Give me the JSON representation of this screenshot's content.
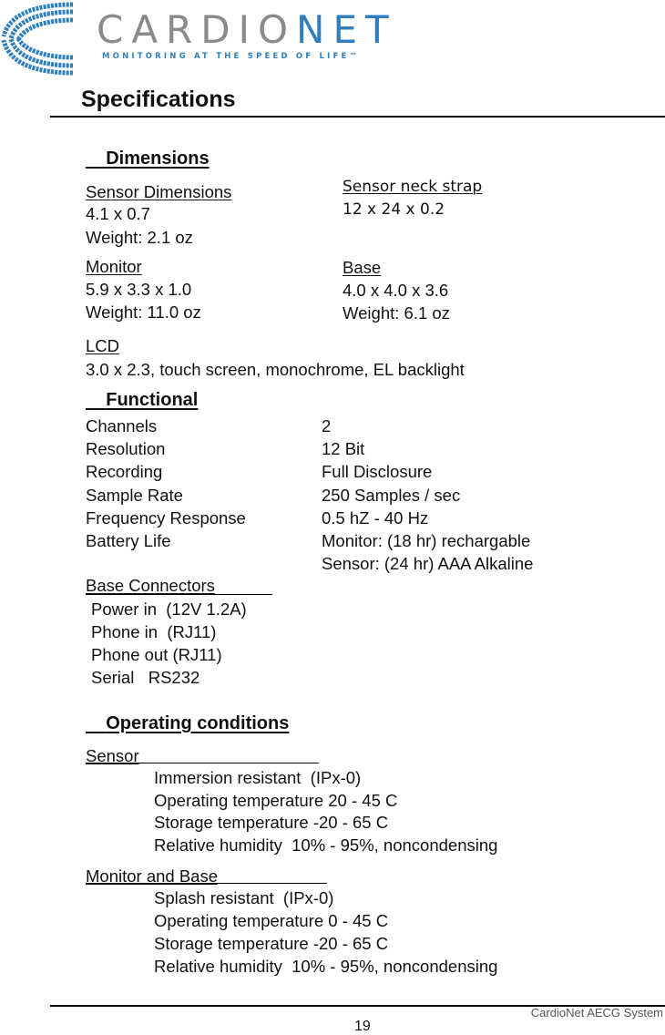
{
  "header": {
    "brand_primary": "CARDIO",
    "brand_secondary": "NET",
    "tagline": "MONITORING AT THE SPEED OF LIFE™",
    "brand_colors": {
      "gray": "#8a8a8a",
      "blue": "#2f7fbf"
    }
  },
  "page_title": "Specifications",
  "dimensions": {
    "heading": "Dimensions",
    "sensor": {
      "label": "Sensor Dimensions",
      "size": "4.1 x 0.7",
      "weight": "Weight: 2.1 oz"
    },
    "neck_strap": {
      "label": "Sensor neck strap",
      "size": "12 x 24 x 0.2"
    },
    "monitor": {
      "label": "Monitor",
      "size": "5.9 x 3.3 x 1.0",
      "weight": "Weight: 11.0 oz"
    },
    "base": {
      "label": "Base",
      "size": "4.0 x 4.0 x 3.6",
      "weight": "Weight: 6.1 oz"
    },
    "lcd": {
      "label": "LCD",
      "desc": "3.0 x 2.3, touch screen, monochrome, EL backlight"
    }
  },
  "functional": {
    "heading": "Functional",
    "rows": [
      {
        "label": "Channels",
        "value": "2"
      },
      {
        "label": "Resolution",
        "value": "12 Bit"
      },
      {
        "label": "Recording",
        "value": "Full Disclosure"
      },
      {
        "label": "Sample Rate",
        "value": "250 Samples / sec"
      },
      {
        "label": "Frequency Response",
        "value": "0.5 hZ - 40 Hz"
      },
      {
        "label": "Battery Life",
        "value": "Monitor: (18 hr) rechargable"
      },
      {
        "label": "",
        "value": "Sensor: (24 hr) AAA Alkaline"
      }
    ],
    "connectors": {
      "label": "Base Connectors",
      "items": [
        "Power in  (12V 1.2A)",
        "Phone in  (RJ11)",
        "Phone out (RJ11)",
        "Serial   RS232"
      ]
    }
  },
  "operating": {
    "heading": "Operating conditions",
    "sensor": {
      "label": "Sensor",
      "items": [
        "Immersion resistant  (IPx-0)",
        "Operating temperature 20 - 45 C",
        "Storage temperature -20 - 65 C",
        "Relative humidity  10% - 95%, noncondensing"
      ]
    },
    "monitor_base": {
      "label": "Monitor and Base",
      "items": [
        "Splash resistant  (IPx-0)",
        "Operating temperature 0 - 45 C",
        "Storage temperature -20 - 65 C",
        "Relative humidity  10% - 95%, noncondensing"
      ]
    }
  },
  "footer": {
    "doc_title": "CardioNet AECG System",
    "page_number": "19"
  }
}
